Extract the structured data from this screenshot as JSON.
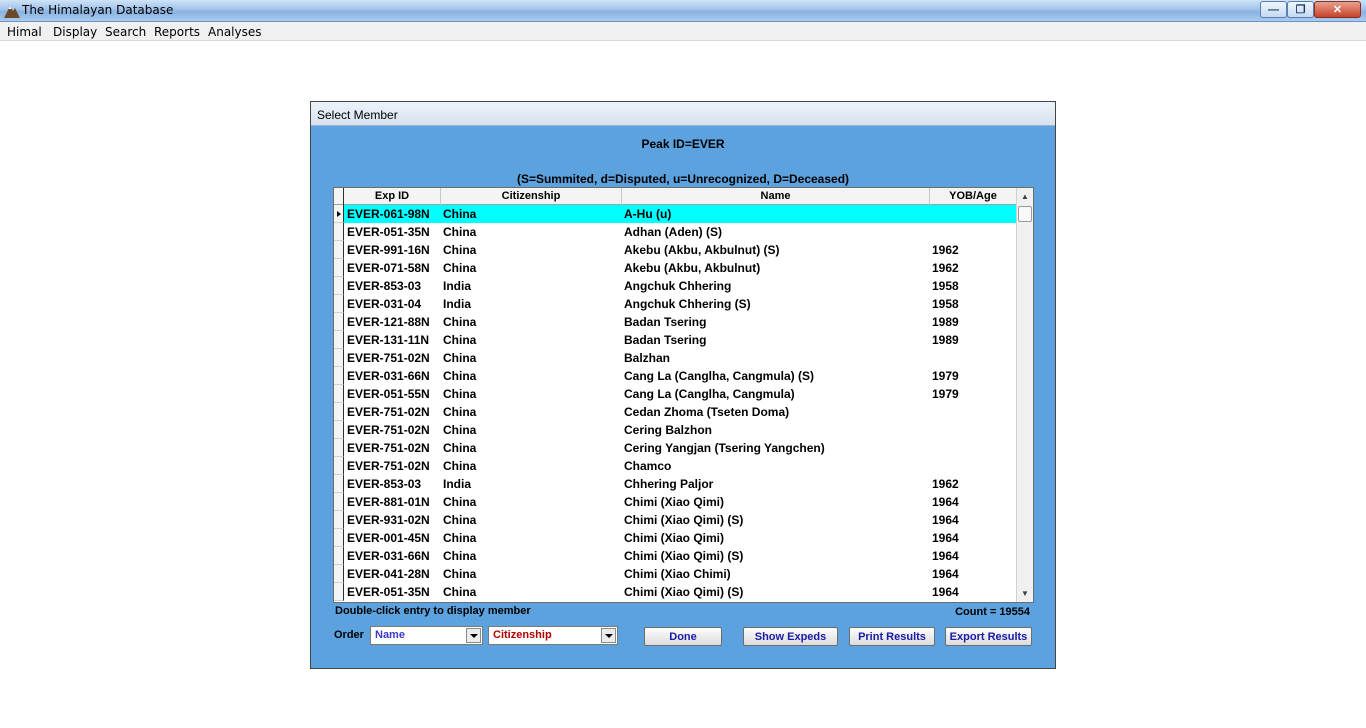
{
  "window": {
    "title": "The Himalayan Database"
  },
  "menu": [
    "Himal",
    "Display",
    "Search",
    "Reports",
    "Analyses"
  ],
  "dialog": {
    "title": "Select Member",
    "peak_id": "Peak ID=EVER",
    "legend": "(S=Summited, d=Disputed, u=Unrecognized, D=Deceased)",
    "columns": [
      "Exp ID",
      "Citizenship",
      "Name",
      "YOB/Age"
    ],
    "rows": [
      {
        "exp_id": "EVER-061-98N",
        "citizenship": "China",
        "name": "A-Hu (u)",
        "yob": "",
        "selected": true
      },
      {
        "exp_id": "EVER-051-35N",
        "citizenship": "China",
        "name": "Adhan (Aden) (S)",
        "yob": ""
      },
      {
        "exp_id": "EVER-991-16N",
        "citizenship": "China",
        "name": "Akebu (Akbu, Akbulnut) (S)",
        "yob": "1962"
      },
      {
        "exp_id": "EVER-071-58N",
        "citizenship": "China",
        "name": "Akebu (Akbu, Akbulnut)",
        "yob": "1962"
      },
      {
        "exp_id": "EVER-853-03",
        "citizenship": "India",
        "name": "Angchuk Chhering",
        "yob": "1958"
      },
      {
        "exp_id": "EVER-031-04",
        "citizenship": "India",
        "name": "Angchuk Chhering (S)",
        "yob": "1958"
      },
      {
        "exp_id": "EVER-121-88N",
        "citizenship": "China",
        "name": "Badan Tsering",
        "yob": "1989"
      },
      {
        "exp_id": "EVER-131-11N",
        "citizenship": "China",
        "name": "Badan Tsering",
        "yob": "1989"
      },
      {
        "exp_id": "EVER-751-02N",
        "citizenship": "China",
        "name": "Balzhan",
        "yob": ""
      },
      {
        "exp_id": "EVER-031-66N",
        "citizenship": "China",
        "name": "Cang La (Canglha, Cangmula) (S)",
        "yob": "1979"
      },
      {
        "exp_id": "EVER-051-55N",
        "citizenship": "China",
        "name": "Cang La (Canglha, Cangmula)",
        "yob": "1979"
      },
      {
        "exp_id": "EVER-751-02N",
        "citizenship": "China",
        "name": "Cedan Zhoma (Tseten Doma)",
        "yob": ""
      },
      {
        "exp_id": "EVER-751-02N",
        "citizenship": "China",
        "name": "Cering Balzhon",
        "yob": ""
      },
      {
        "exp_id": "EVER-751-02N",
        "citizenship": "China",
        "name": "Cering Yangjan (Tsering Yangchen)",
        "yob": ""
      },
      {
        "exp_id": "EVER-751-02N",
        "citizenship": "China",
        "name": "Chamco",
        "yob": ""
      },
      {
        "exp_id": "EVER-853-03",
        "citizenship": "India",
        "name": "Chhering Paljor",
        "yob": "1962"
      },
      {
        "exp_id": "EVER-881-01N",
        "citizenship": "China",
        "name": "Chimi (Xiao Qimi)",
        "yob": "1964"
      },
      {
        "exp_id": "EVER-931-02N",
        "citizenship": "China",
        "name": "Chimi (Xiao Qimi) (S)",
        "yob": "1964"
      },
      {
        "exp_id": "EVER-001-45N",
        "citizenship": "China",
        "name": "Chimi (Xiao Qimi)",
        "yob": "1964"
      },
      {
        "exp_id": "EVER-031-66N",
        "citizenship": "China",
        "name": "Chimi (Xiao Qimi) (S)",
        "yob": "1964"
      },
      {
        "exp_id": "EVER-041-28N",
        "citizenship": "China",
        "name": "Chimi (Xiao Chimi)",
        "yob": "1964"
      },
      {
        "exp_id": "EVER-051-35N",
        "citizenship": "China",
        "name": "Chimi (Xiao Qimi) (S)",
        "yob": "1964"
      }
    ],
    "hint": "Double-click entry to display member",
    "count": "Count = 19554",
    "order_label": "Order",
    "order1": "Name",
    "order2": "Citizenship",
    "order1_color": "#3a3ad0",
    "order2_color": "#b00000",
    "buttons": {
      "done": "Done",
      "show_expeds": "Show Expeds",
      "print_results": "Print Results",
      "export_results": "Export Results"
    },
    "colors": {
      "background": "#5ba2df",
      "selected_row": "#00ffff",
      "button_text": "#1a1aa6"
    }
  }
}
